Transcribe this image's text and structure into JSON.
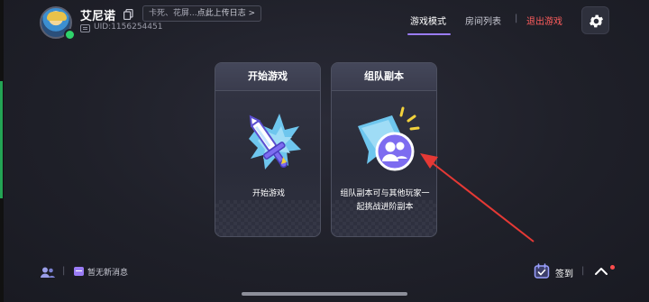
{
  "header": {
    "username": "艾尼诺",
    "status_text": "卡死、花屏...",
    "status_link": "点此上传日志 >",
    "uid": "UID:1156254451"
  },
  "tabs": {
    "mode": "游戏模式",
    "rooms": "房间列表",
    "separator": "|",
    "exit": "退出游戏"
  },
  "cards": {
    "start": {
      "title": "开始游戏",
      "desc": "开始游戏"
    },
    "team": {
      "title": "组队副本",
      "desc": "组队副本可与其他玩家一起挑战进阶副本"
    }
  },
  "footer": {
    "separator": "|",
    "messages": "暂无新消息",
    "signin": "签到"
  },
  "colors": {
    "accent": "#9a7cf5",
    "exit": "#ff5d5d",
    "online": "#2fd36b",
    "annotation_arrow": "#e53935"
  },
  "icons": [
    "avatar",
    "copy-icon",
    "id-card-icon",
    "gear-icon",
    "sword-icon",
    "team-chat-icon",
    "friends-icon",
    "message-icon",
    "calendar-check-icon",
    "chevron-up-icon"
  ]
}
